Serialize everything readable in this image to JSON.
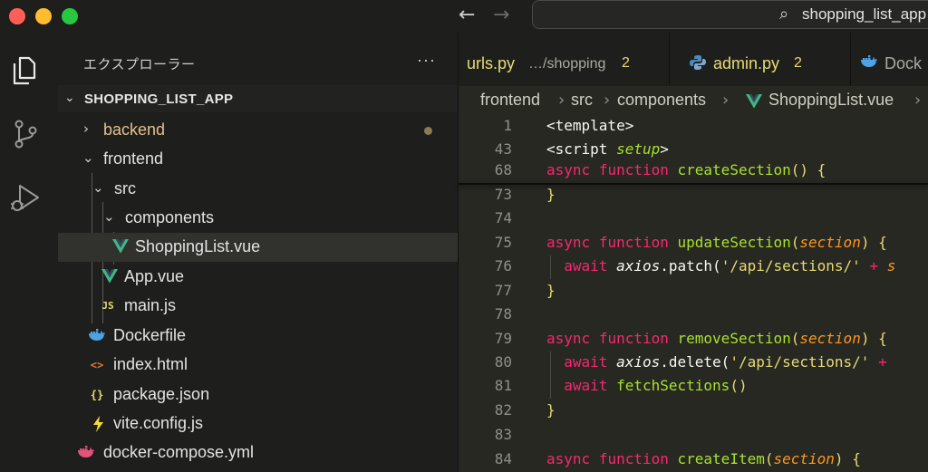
{
  "window": {
    "command_center_text": "shopping_list_app"
  },
  "explorer": {
    "title": "エクスプローラー",
    "more_label": "···",
    "root": "SHOPPING_LIST_APP",
    "items": [
      {
        "label": "backend",
        "icon": "folder-chevron",
        "expanded": false,
        "modified": true
      },
      {
        "label": "frontend",
        "icon": "folder-chevron",
        "expanded": true
      },
      {
        "label": "src",
        "icon": "folder-chevron",
        "expanded": true
      },
      {
        "label": "components",
        "icon": "folder-chevron",
        "expanded": true
      },
      {
        "label": "ShoppingList.vue",
        "icon": "vue-icon",
        "selected": true
      },
      {
        "label": "App.vue",
        "icon": "vue-icon"
      },
      {
        "label": "main.js",
        "icon": "js-icon",
        "icon_text": "JS"
      },
      {
        "label": "Dockerfile",
        "icon": "docker-icon"
      },
      {
        "label": "index.html",
        "icon": "html-icon",
        "icon_text": "<>"
      },
      {
        "label": "package.json",
        "icon": "json-icon",
        "icon_text": "{}"
      },
      {
        "label": "vite.config.js",
        "icon": "vite-icon"
      },
      {
        "label": "docker-compose.yml",
        "icon": "docker-icon"
      }
    ]
  },
  "tabs": [
    {
      "name": "urls.py",
      "path": "…/shopping",
      "count": "2"
    },
    {
      "name": "admin.py",
      "count": "2",
      "icon": "python-icon"
    },
    {
      "name": "Dock",
      "icon": "docker-icon"
    }
  ],
  "breadcrumb": [
    "frontend",
    "src",
    "components",
    "ShoppingList.vue"
  ],
  "code": [
    {
      "line": "1"
    },
    {
      "line": "43"
    },
    {
      "line": "68"
    },
    {
      "line": "73"
    },
    {
      "line": "74"
    },
    {
      "line": "75"
    },
    {
      "line": "76"
    },
    {
      "line": "77"
    },
    {
      "line": "78"
    },
    {
      "line": "79"
    },
    {
      "line": "80"
    },
    {
      "line": "81"
    },
    {
      "line": "82"
    },
    {
      "line": "83"
    },
    {
      "line": "84"
    }
  ],
  "code_text": {
    "template_tag": "<template>",
    "script_open": "<script ",
    "setup_attr": "setup",
    "script_close": ">",
    "kw_async": "async",
    "kw_function": "function",
    "kw_await": "await",
    "fn_createSection": "createSection",
    "fn_updateSection": "updateSection",
    "fn_removeSection": "removeSection",
    "fn_createItem": "createItem",
    "fn_fetchSections": "fetchSections",
    "param_section": "section",
    "axios": "axios",
    "patch": ".patch(",
    "delete": ".delete(",
    "url_sections": "'/api/sections/'",
    "plus": " + ",
    "s_cut": "s",
    "paren_empty": "()",
    "paren_open": "(",
    "paren_close": ")",
    "brace_open": " {",
    "brace_close": "}"
  },
  "colors": {
    "accent_vue": "#41b883",
    "docker": "#4ea3e4",
    "keyword": "#f92672",
    "function": "#a6e22e",
    "string": "#e6db74",
    "param": "#fd971f"
  }
}
